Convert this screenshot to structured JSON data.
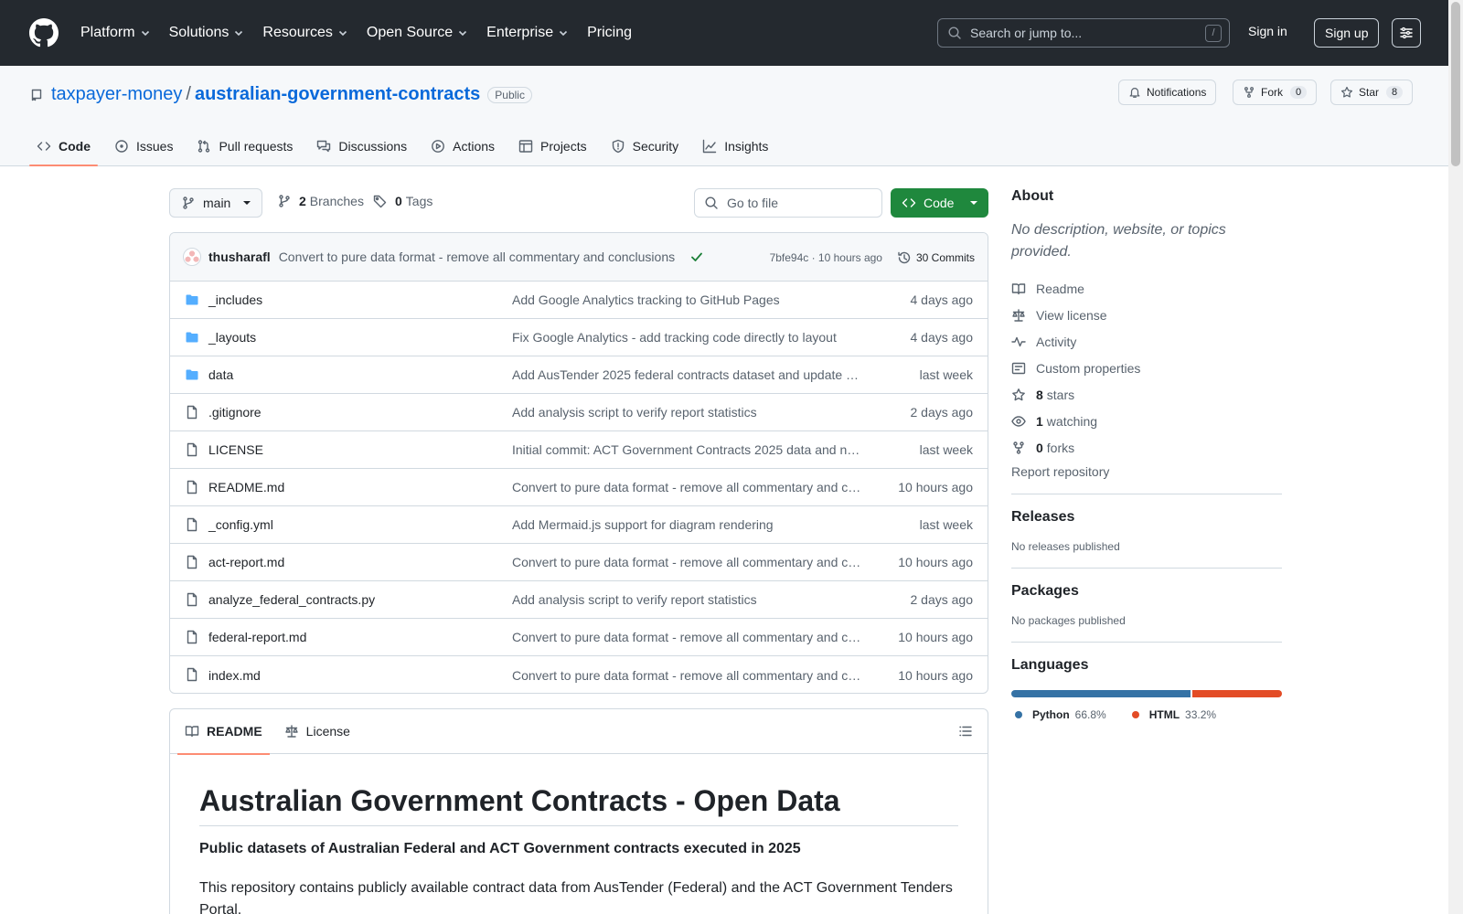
{
  "nav": {
    "items": [
      "Platform",
      "Solutions",
      "Resources",
      "Open Source",
      "Enterprise"
    ],
    "pricing": "Pricing",
    "search_placeholder": "Search or jump to...",
    "search_key": "/",
    "sign_in": "Sign in",
    "sign_up": "Sign up"
  },
  "repo": {
    "owner": "taxpayer-money",
    "separator": "/",
    "name": "australian-government-contracts",
    "visibility": "Public",
    "notifications": "Notifications",
    "fork_label": "Fork",
    "fork_count": "0",
    "star_label": "Star",
    "star_count": "8"
  },
  "tabs": [
    "Code",
    "Issues",
    "Pull requests",
    "Discussions",
    "Actions",
    "Projects",
    "Security",
    "Insights"
  ],
  "toolbar": {
    "branch": "main",
    "branches_count": "2",
    "branches_label": "Branches",
    "tags_count": "0",
    "tags_label": "Tags",
    "goto_placeholder": "Go to file",
    "code_button": "Code"
  },
  "commit": {
    "author": "thusharafl",
    "message": "Convert to pure data format - remove all commentary and conclusions",
    "hash_time": "7bfe94c · 10 hours ago",
    "commits": "30 Commits"
  },
  "files": [
    {
      "name": "_includes",
      "type": "folder",
      "message": "Add Google Analytics tracking to GitHub Pages",
      "age": "4 days ago"
    },
    {
      "name": "_layouts",
      "type": "folder",
      "message": "Fix Google Analytics - add tracking code directly to layout",
      "age": "4 days ago"
    },
    {
      "name": "data",
      "type": "folder",
      "message": "Add AusTender 2025 federal contracts dataset and update …",
      "age": "last week"
    },
    {
      "name": ".gitignore",
      "type": "file",
      "message": "Add analysis script to verify report statistics",
      "age": "2 days ago"
    },
    {
      "name": "LICENSE",
      "type": "file",
      "message": "Initial commit: ACT Government Contracts 2025 data and n…",
      "age": "last week"
    },
    {
      "name": "README.md",
      "type": "file",
      "message": "Convert to pure data format - remove all commentary and c…",
      "age": "10 hours ago"
    },
    {
      "name": "_config.yml",
      "type": "file",
      "message": "Add Mermaid.js support for diagram rendering",
      "age": "last week"
    },
    {
      "name": "act-report.md",
      "type": "file",
      "message": "Convert to pure data format - remove all commentary and c…",
      "age": "10 hours ago"
    },
    {
      "name": "analyze_federal_contracts.py",
      "type": "file",
      "message": "Add analysis script to verify report statistics",
      "age": "2 days ago"
    },
    {
      "name": "federal-report.md",
      "type": "file",
      "message": "Convert to pure data format - remove all commentary and c…",
      "age": "10 hours ago"
    },
    {
      "name": "index.md",
      "type": "file",
      "message": "Convert to pure data format - remove all commentary and c…",
      "age": "10 hours ago"
    }
  ],
  "readme": {
    "tab_readme": "README",
    "tab_license": "License",
    "title": "Australian Government Contracts - Open Data",
    "subtitle": "Public datasets of Australian Federal and ACT Government contracts executed in 2025",
    "paragraph": "This repository contains publicly available contract data from AusTender (Federal) and the ACT Government Tenders Portal."
  },
  "about": {
    "heading": "About",
    "description": "No description, website, or topics provided.",
    "readme": "Readme",
    "license": "View license",
    "activity": "Activity",
    "custom_properties": "Custom properties",
    "stars_count": "8",
    "stars_label": "stars",
    "watching_count": "1",
    "watching_label": "watching",
    "forks_count": "0",
    "forks_label": "forks",
    "report": "Report repository"
  },
  "releases": {
    "heading": "Releases",
    "text": "No releases published"
  },
  "packages": {
    "heading": "Packages",
    "text": "No packages published"
  },
  "languages": {
    "heading": "Languages",
    "items": [
      {
        "name": "Python",
        "percent": "66.8%",
        "value": 66.8,
        "color": "#3572A5"
      },
      {
        "name": "HTML",
        "percent": "33.2%",
        "value": 33.2,
        "color": "#e34c26"
      }
    ]
  }
}
